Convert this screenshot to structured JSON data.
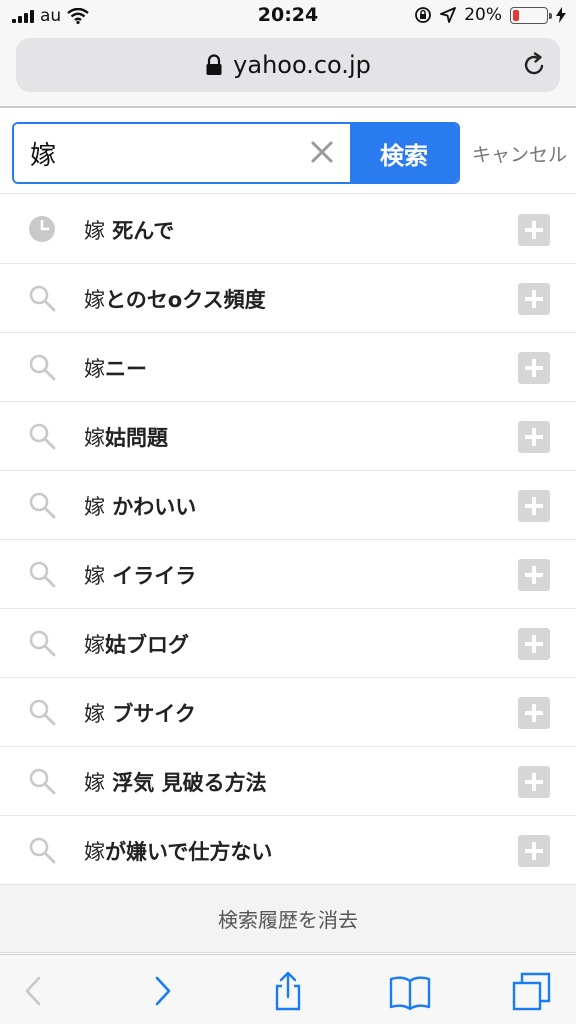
{
  "status_bar": {
    "carrier": "au",
    "time": "20:24",
    "battery_percent": "20%",
    "battery_level": 0.2,
    "battery_color": "#e53935"
  },
  "browser": {
    "url": "yahoo.co.jp",
    "icons": [
      "lock-icon",
      "reload-icon"
    ]
  },
  "search": {
    "query": "嫁",
    "button_label": "検索",
    "cancel_label": "キャンセル",
    "accent_color": "#2b7bf0"
  },
  "suggestions": [
    {
      "type": "history",
      "icon": "clock-icon",
      "prefix": "嫁",
      "rest": " 死んで"
    },
    {
      "type": "suggest",
      "icon": "search-icon",
      "prefix": "嫁",
      "rest": "とのセoクス頻度"
    },
    {
      "type": "suggest",
      "icon": "search-icon",
      "prefix": "嫁",
      "rest": "ニー"
    },
    {
      "type": "suggest",
      "icon": "search-icon",
      "prefix": "嫁",
      "rest": "姑問題"
    },
    {
      "type": "suggest",
      "icon": "search-icon",
      "prefix": "嫁",
      "rest": " かわいい"
    },
    {
      "type": "suggest",
      "icon": "search-icon",
      "prefix": "嫁",
      "rest": " イライラ"
    },
    {
      "type": "suggest",
      "icon": "search-icon",
      "prefix": "嫁",
      "rest": "姑ブログ"
    },
    {
      "type": "suggest",
      "icon": "search-icon",
      "prefix": "嫁",
      "rest": " ブサイク"
    },
    {
      "type": "suggest",
      "icon": "search-icon",
      "prefix": "嫁",
      "rest": " 浮気 見破る方法"
    },
    {
      "type": "suggest",
      "icon": "search-icon",
      "prefix": "嫁",
      "rest": "が嫌いで仕方ない"
    }
  ],
  "clear_history_label": "検索履歴を消去",
  "toolbar": {
    "icons": [
      "back-icon",
      "forward-icon",
      "share-icon",
      "bookmarks-icon",
      "tabs-icon"
    ],
    "accent_color": "#1a7cf5"
  }
}
